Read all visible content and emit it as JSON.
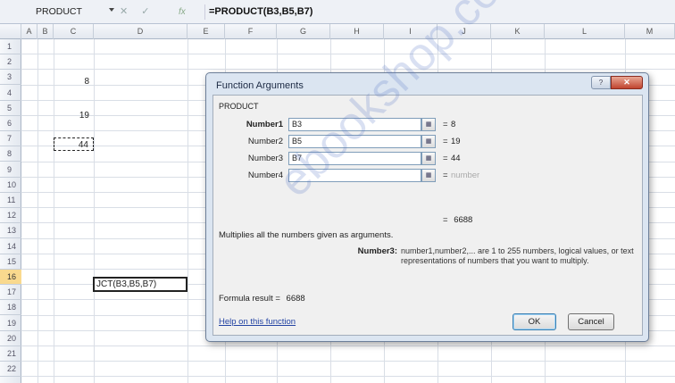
{
  "formula_bar": {
    "name_box": "PRODUCT",
    "buttons": "✕ ✓",
    "fx": "fx",
    "formula": "=PRODUCT(B3,B5,B7)"
  },
  "columns": [
    "A",
    "B",
    "C",
    "D",
    "E",
    "F",
    "G",
    "H",
    "I",
    "J",
    "K",
    "L",
    "M"
  ],
  "rows": [
    "1",
    "2",
    "3",
    "4",
    "5",
    "6",
    "7",
    "8",
    "9",
    "10",
    "11",
    "12",
    "13",
    "14",
    "15",
    "16",
    "17",
    "18",
    "19",
    "20",
    "21",
    "22"
  ],
  "cells": {
    "b3": "8",
    "b5": "19",
    "b7": "44",
    "c16": "JCT(B3,B5,B7)"
  },
  "dialog": {
    "title": "Function Arguments",
    "help_button": "?",
    "close_button": "✕",
    "function_name": "PRODUCT",
    "args": [
      {
        "label": "Number1",
        "value": "B3",
        "equals": "=",
        "result": "8"
      },
      {
        "label": "Number2",
        "value": "B5",
        "equals": "=",
        "result": "19"
      },
      {
        "label": "Number3",
        "value": "B7",
        "equals": "=",
        "result": "44"
      },
      {
        "label": "Number4",
        "value": "",
        "equals": "=",
        "result": "number"
      }
    ],
    "result_equals": "=",
    "result_value": "6688",
    "description": "Multiplies all the numbers given as arguments.",
    "arg_name": "Number3:",
    "arg_description": "number1,number2,... are 1 to 255 numbers, logical values, or text representations of numbers that you want to multiply.",
    "formula_result_label": "Formula result =",
    "formula_result_value": "6688",
    "help_link": "Help on this function",
    "ok_label": "OK",
    "cancel_label": "Cancel"
  },
  "watermark": "ebookshop.com"
}
